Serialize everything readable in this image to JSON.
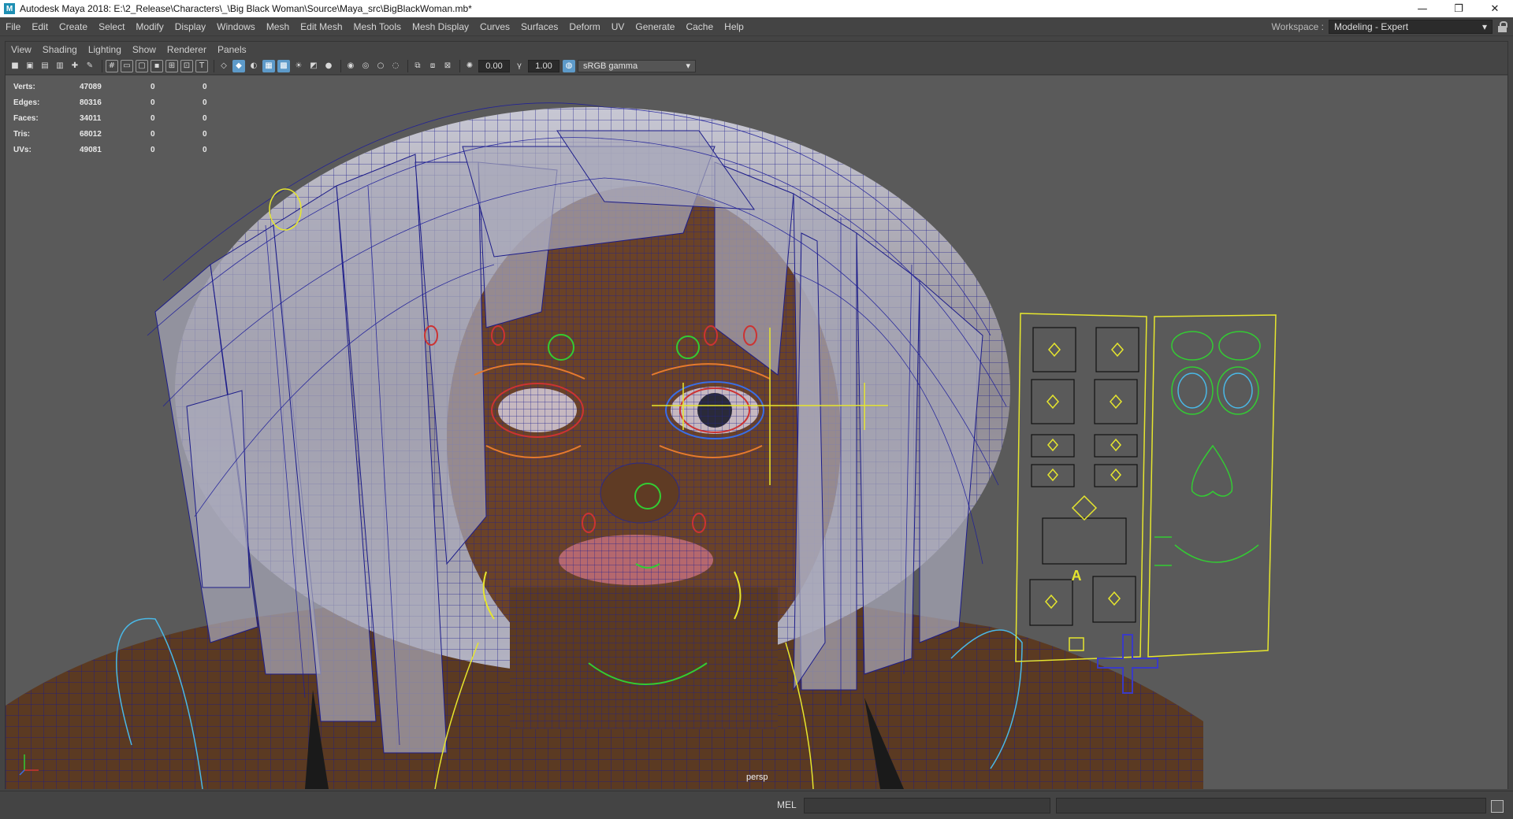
{
  "window": {
    "app_icon": "M",
    "title": "Autodesk Maya 2018: E:\\2_Release\\Characters\\_\\Big Black Woman\\Source\\Maya_src\\BigBlackWoman.mb*",
    "minimize_glyph": "—",
    "maximize_glyph": "❐",
    "close_glyph": "✕"
  },
  "menubar": {
    "items": [
      "File",
      "Edit",
      "Create",
      "Select",
      "Modify",
      "Display",
      "Windows",
      "Mesh",
      "Edit Mesh",
      "Mesh Tools",
      "Mesh Display",
      "Curves",
      "Surfaces",
      "Deform",
      "UV",
      "Generate",
      "Cache",
      "Help"
    ],
    "workspace_label": "Workspace :",
    "workspace_value": "Modeling - Expert"
  },
  "panel": {
    "menus": [
      "View",
      "Shading",
      "Lighting",
      "Show",
      "Renderer",
      "Panels"
    ],
    "toolbar": {
      "exposure": "0.00",
      "gamma": "1.00",
      "color_space": "sRGB gamma"
    }
  },
  "hud": {
    "rows": [
      {
        "label": "Verts:",
        "value": "47089",
        "sel": "0",
        "extra": "0"
      },
      {
        "label": "Edges:",
        "value": "80316",
        "sel": "0",
        "extra": "0"
      },
      {
        "label": "Faces:",
        "value": "34011",
        "sel": "0",
        "extra": "0"
      },
      {
        "label": "Tris:",
        "value": "68012",
        "sel": "0",
        "extra": "0"
      },
      {
        "label": "UVs:",
        "value": "49081",
        "sel": "0",
        "extra": "0"
      }
    ]
  },
  "viewport": {
    "camera": "persp",
    "face_ctrl_marker": "A",
    "colors": {
      "background": "#5a5a5a",
      "skin": "#5b3a22",
      "wireframe": "#1a1a8c",
      "hair": "#9a9aaa",
      "ctrl_yellow": "#e6e62e",
      "ctrl_green": "#33cc33",
      "ctrl_red": "#cc3333",
      "ctrl_blue": "#3a6ee6",
      "ctrl_cyan": "#4ab8e6",
      "ctrl_orange": "#e67a2e"
    }
  },
  "cmdline": {
    "language": "MEL"
  }
}
